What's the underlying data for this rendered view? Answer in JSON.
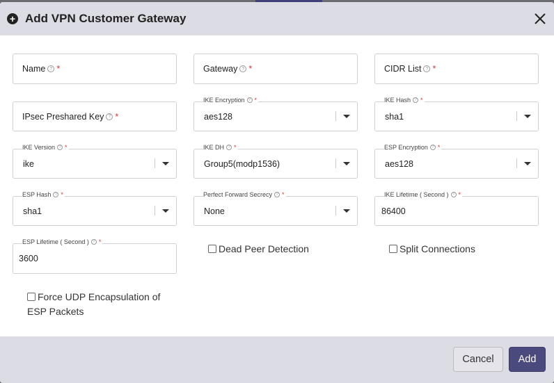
{
  "dialog": {
    "title": "Add VPN Customer Gateway",
    "close_icon": "close-icon",
    "header_icon": "plus-circle-icon"
  },
  "fields": {
    "name": {
      "label": "Name",
      "required": "*"
    },
    "gateway": {
      "label": "Gateway",
      "required": "*"
    },
    "cidr_list": {
      "label": "CIDR List",
      "required": "*"
    },
    "ipsec_key": {
      "label": "IPsec Preshared Key",
      "required": "*"
    },
    "ike_encryption": {
      "label": "IKE Encryption",
      "required": "*",
      "value": "aes128"
    },
    "ike_hash": {
      "label": "IKE Hash",
      "required": "*",
      "value": "sha1"
    },
    "ike_version": {
      "label": "IKE Version",
      "required": "*",
      "value": "ike"
    },
    "ike_dh": {
      "label": "IKE DH",
      "required": "*",
      "value": "Group5(modp1536)"
    },
    "esp_encryption": {
      "label": "ESP Encryption",
      "required": "*",
      "value": "aes128"
    },
    "esp_hash": {
      "label": "ESP Hash",
      "required": "*",
      "value": "sha1"
    },
    "pfs": {
      "label": "Perfect Forward Secrecy",
      "required": "*",
      "value": "None"
    },
    "ike_lifetime": {
      "label": "IKE Lifetime ( Second )",
      "required": "*",
      "value": "86400"
    },
    "esp_lifetime": {
      "label": "ESP Lifetime ( Second )",
      "required": "*",
      "value": "3600"
    }
  },
  "checkboxes": {
    "dpd": "Dead Peer Detection",
    "split": "Split Connections",
    "force_udp": "Force UDP Encapsulation of ESP Packets"
  },
  "footer": {
    "cancel_label": "Cancel",
    "add_label": "Add"
  },
  "colors": {
    "primary": "#4b4a7e",
    "required": "#dd3333",
    "header_bg": "#dcdce4"
  }
}
